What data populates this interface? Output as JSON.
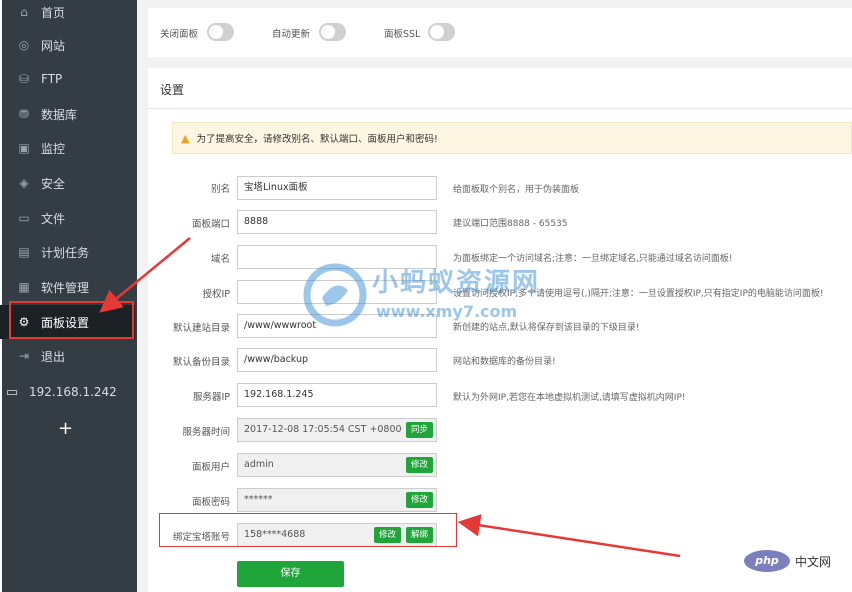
{
  "sidebar": {
    "items": [
      {
        "icon": "home-icon",
        "glyph": "⌂",
        "label": "首页"
      },
      {
        "icon": "globe-icon",
        "glyph": "◎",
        "label": "网站"
      },
      {
        "icon": "ftp-icon",
        "glyph": "⛁",
        "label": "FTP"
      },
      {
        "icon": "database-icon",
        "glyph": "⛃",
        "label": "数据库"
      },
      {
        "icon": "monitor-icon",
        "glyph": "▣",
        "label": "监控"
      },
      {
        "icon": "shield-icon",
        "glyph": "◈",
        "label": "安全"
      },
      {
        "icon": "folder-icon",
        "glyph": "▭",
        "label": "文件"
      },
      {
        "icon": "calendar-icon",
        "glyph": "▤",
        "label": "计划任务"
      },
      {
        "icon": "grid-icon",
        "glyph": "▦",
        "label": "软件管理"
      },
      {
        "icon": "gear-icon",
        "glyph": "⚙",
        "label": "面板设置"
      },
      {
        "icon": "logout-icon",
        "glyph": "⇥",
        "label": "退出"
      }
    ],
    "active_index": 9,
    "server_ip": "192.168.1.242",
    "add_glyph": "+"
  },
  "toggles": {
    "close_panel": {
      "label": "关闭面板",
      "on": false
    },
    "auto_update": {
      "label": "自动更新",
      "on": false
    },
    "panel_ssl": {
      "label": "面板SSL",
      "on": false
    }
  },
  "settings": {
    "title": "设置",
    "warning": "为了提高安全，请修改别名、默认端口、面板用户和密码!",
    "fields": {
      "alias": {
        "label": "别名",
        "value": "宝塔Linux面板",
        "hint": "给面板取个别名，用于伪装面板"
      },
      "port": {
        "label": "面板端口",
        "value": "8888",
        "hint": "建议端口范围8888 - 65535"
      },
      "domain": {
        "label": "域名",
        "value": "",
        "hint": "为面板绑定一个访问域名;注意：一旦绑定域名,只能通过域名访问面板!"
      },
      "auth_ip": {
        "label": "授权IP",
        "value": "",
        "hint": "设置访问授权IP,多个请使用逗号(,)隔开;注意：一旦设置授权IP,只有指定IP的电脑能访问面板!"
      },
      "site_dir": {
        "label": "默认建站目录",
        "value": "/www/wwwroot",
        "hint": "新创建的站点,默认将保存到该目录的下级目录!"
      },
      "backup_dir": {
        "label": "默认备份目录",
        "value": "/www/backup",
        "hint": "网站和数据库的备份目录!"
      },
      "server_ip": {
        "label": "服务器IP",
        "value": "192.168.1.245",
        "hint": "默认为外网IP,若您在本地虚拟机测试,请填写虚拟机内网IP!"
      },
      "server_time": {
        "label": "服务器时间",
        "value": "2017-12-08 17:05:54 CST +0800",
        "button": "同步"
      },
      "panel_user": {
        "label": "面板用户",
        "value": "admin",
        "button": "修改"
      },
      "panel_pass": {
        "label": "面板密码",
        "value": "******",
        "button": "修改"
      },
      "bt_account": {
        "label": "绑定宝塔账号",
        "value": "158****4688",
        "button_edit": "修改",
        "button_unbind": "解绑"
      }
    },
    "save_label": "保存"
  },
  "overlay": {
    "watermark_main": "小蚂蚁资源网",
    "watermark_url": "www.xmy7.com",
    "php_logo": "php",
    "php_text": "中文网"
  },
  "colors": {
    "sidebar_bg": "#353d44",
    "accent_green": "#20a53a",
    "annotation_red": "#e53935"
  }
}
